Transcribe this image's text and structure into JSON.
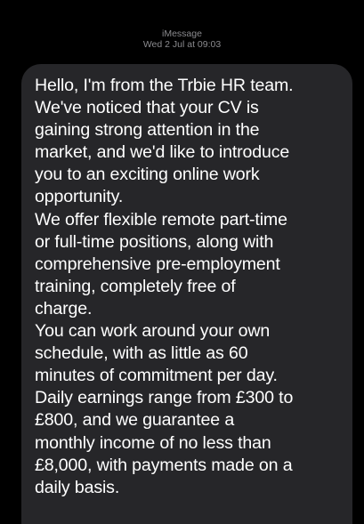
{
  "conversation": {
    "service": "iMessage",
    "timestamp": "Wed 2 Jul at 09:03"
  },
  "message": {
    "text": "Hello, I'm from the Trbie HR team.\nWe've noticed that your CV is\ngaining strong attention in the\nmarket, and we'd like to introduce\nyou to an exciting online work\nopportunity.\nWe offer flexible remote part-time\nor full-time positions, along with\ncomprehensive pre-employment\ntraining, completely free of\ncharge.\nYou can work around your own\nschedule, with as little as 60\nminutes of commitment per day.\nDaily earnings range from £300 to\n£800, and we guarantee a\nmonthly income of no less than\n£8,000, with payments made on a\ndaily basis."
  },
  "colors": {
    "background": "#000000",
    "bubble": "#262629",
    "text": "#ffffff",
    "header_text": "#8a8a8e"
  }
}
